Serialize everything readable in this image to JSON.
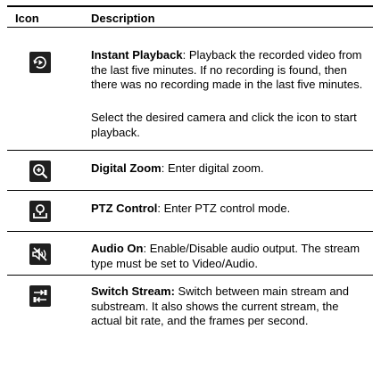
{
  "header": {
    "icon": "Icon",
    "description": "Description"
  },
  "rows": [
    {
      "icon": "instant-playback-icon",
      "title": "Instant Playback",
      "sep": ":",
      "text": " Playback the recorded video from the last five minutes. If no recording is found, then there was no recording made in the last five minutes.",
      "extra": "Select the desired camera and click the icon to start playback."
    },
    {
      "icon": "digital-zoom-icon",
      "title": "Digital Zoom",
      "sep": ":",
      "text": " Enter digital zoom."
    },
    {
      "icon": "ptz-control-icon",
      "title": "PTZ Control",
      "sep": ":",
      "text": " Enter PTZ control mode."
    },
    {
      "icon": "audio-on-icon",
      "title": "Audio On",
      "sep": ":",
      "text": " Enable/Disable audio output. The stream type must be set to Video/Audio."
    },
    {
      "icon": "switch-stream-icon",
      "title": "Switch Stream:",
      "sep": "",
      "text": " Switch between main stream and substream. It also shows the current stream, the actual bit rate, and the frames per second."
    }
  ]
}
